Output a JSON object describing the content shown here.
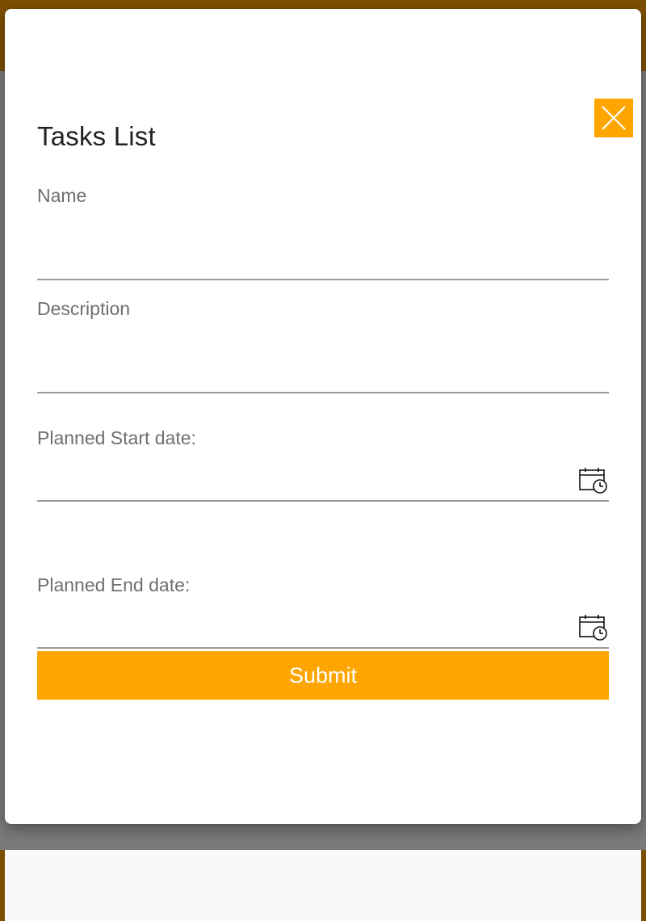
{
  "form": {
    "title": "Tasks List",
    "fields": {
      "name": {
        "label": "Name",
        "value": ""
      },
      "description": {
        "label": "Description",
        "value": ""
      },
      "start_date": {
        "label": "Planned Start date:",
        "value": ""
      },
      "end_date": {
        "label": "Planned End date:",
        "value": ""
      }
    },
    "submit_label": "Submit"
  },
  "icons": {
    "close": "close-icon",
    "calendar": "calendar-clock-icon"
  },
  "colors": {
    "accent": "#ffa500",
    "backdrop_header": "#7d4e00",
    "backdrop": "#7a7a7a",
    "label": "#6f6f6f",
    "underline": "#9a9a9a"
  }
}
